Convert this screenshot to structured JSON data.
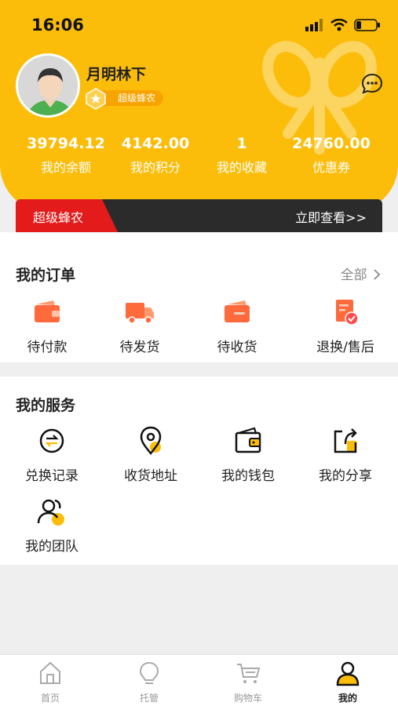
{
  "status_bar": {
    "time": "16:06"
  },
  "profile": {
    "name": "月明林下",
    "level": "超级蜂农"
  },
  "stats": [
    {
      "value": "39794.12",
      "label": "我的余额"
    },
    {
      "value": "4142.00",
      "label": "我的积分"
    },
    {
      "value": "1",
      "label": "我的收藏"
    },
    {
      "value": "24760.00",
      "label": "优惠券"
    }
  ],
  "vip_banner": {
    "title": "超级蜂农",
    "link": "立即查看>>"
  },
  "orders": {
    "title": "我的订单",
    "all_label": "全部",
    "items": [
      {
        "label": "待付款",
        "icon": "wallet-icon"
      },
      {
        "label": "待发货",
        "icon": "truck-icon"
      },
      {
        "label": "待收货",
        "icon": "card-icon"
      },
      {
        "label": "退换/售后",
        "icon": "refund-icon"
      }
    ]
  },
  "services": {
    "title": "我的服务",
    "items": [
      {
        "label": "兑换记录",
        "icon": "exchange-icon"
      },
      {
        "label": "收货地址",
        "icon": "location-icon"
      },
      {
        "label": "我的钱包",
        "icon": "wallet-icon"
      },
      {
        "label": "我的分享",
        "icon": "share-icon"
      },
      {
        "label": "我的团队",
        "icon": "team-icon"
      }
    ]
  },
  "tabbar": {
    "items": [
      {
        "label": "首页",
        "icon": "home-icon"
      },
      {
        "label": "托管",
        "icon": "bulb-icon"
      },
      {
        "label": "购物车",
        "icon": "cart-icon"
      },
      {
        "label": "我的",
        "icon": "user-icon",
        "active": true
      }
    ]
  },
  "colors": {
    "brand": "#fbbd0a",
    "accent_red": "#e31b1b",
    "orange": "#f7a400"
  }
}
